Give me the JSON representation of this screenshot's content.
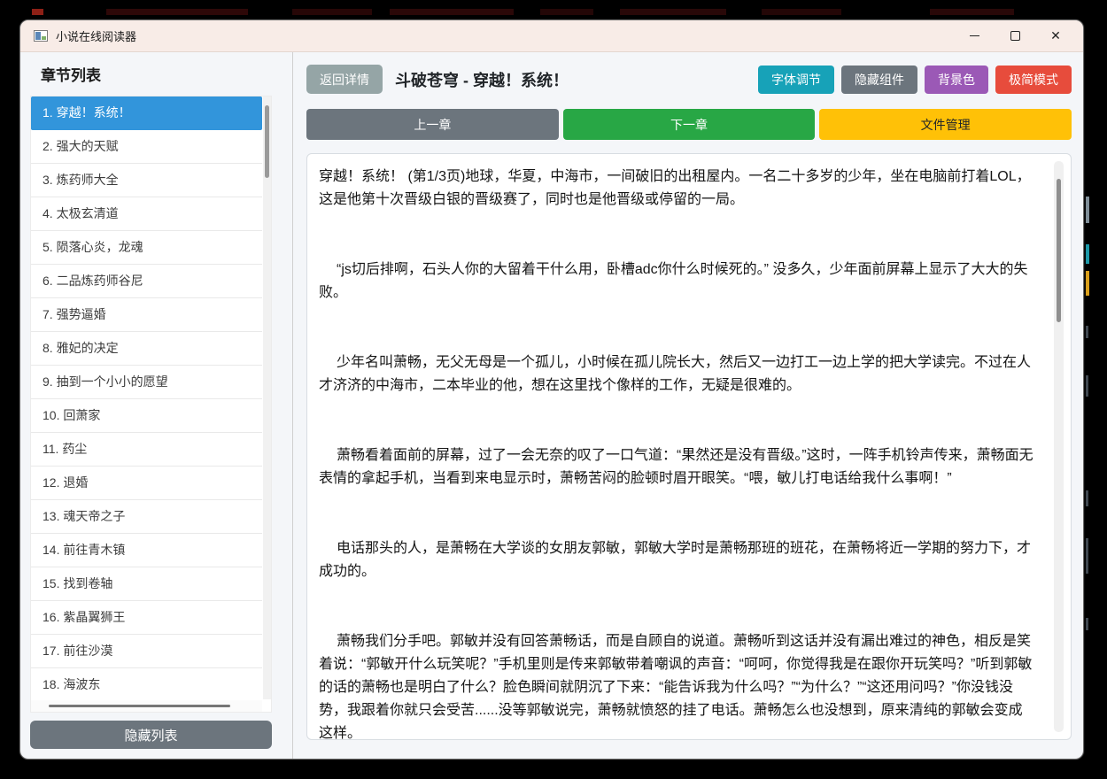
{
  "window": {
    "title": "小说在线阅读器"
  },
  "sidebar": {
    "title": "章节列表",
    "hide_button": "隐藏列表",
    "active_index": 0,
    "chapters": [
      "1. 穿越！系统！",
      "2. 强大的天赋",
      "3. 炼药师大全",
      "4. 太极玄清道",
      "5. 陨落心炎，龙魂",
      "6. 二品炼药师谷尼",
      "7. 强势逼婚",
      "8. 雅妃的决定",
      "9. 抽到一个小小的愿望",
      "10. 回萧家",
      "11. 药尘",
      "12. 退婚",
      "13. 魂天帝之子",
      "14. 前往青木镇",
      "15. 找到卷轴",
      "16. 紫晶翼狮王",
      "17. 前往沙漠",
      "18. 海波东"
    ]
  },
  "toolbar": {
    "back_button": "返回详情",
    "chapter_title": "斗破苍穹 - 穿越！系统！",
    "action_buttons": [
      {
        "id": "font-adjust",
        "label": "字体调节",
        "color": "#17a2b8"
      },
      {
        "id": "hide-widgets",
        "label": "隐藏组件",
        "color": "#6c757d"
      },
      {
        "id": "background-color",
        "label": "背景色",
        "color": "#9b59b6"
      },
      {
        "id": "minimal-mode",
        "label": "极简模式",
        "color": "#e74c3c"
      }
    ]
  },
  "nav": {
    "prev_button": {
      "label": "上一章",
      "color": "#6c757d"
    },
    "next_button": {
      "label": "下一章",
      "color": "#28a745"
    },
    "file_button": {
      "label": "文件管理",
      "color": "#ffc107"
    }
  },
  "reader": {
    "page_indicator": "第1/3页",
    "paragraphs": [
      "穿越！系统！ (第1/3页)地球，华夏，中海市，一间破旧的出租屋内。一名二十多岁的少年，坐在电脑前打着LOL，这是他第十次晋级白银的晋级赛了，同时也是他晋级或停留的一局。",
      "“js切后排啊，石头人你的大留着干什么用，卧槽adc你什么时候死的。” 没多久，少年面前屏幕上显示了大大的失败。",
      "少年名叫萧畅，无父无母是一个孤儿，小时候在孤儿院长大，然后又一边打工一边上学的把大学读完。不过在人才济济的中海市，二本毕业的他，想在这里找个像样的工作，无疑是很难的。",
      "萧畅看着面前的屏幕，过了一会无奈的叹了一口气道：“果然还是没有晋级。”这时，一阵手机铃声传来，萧畅面无表情的拿起手机，当看到来电显示时，萧畅苦闷的脸顿时眉开眼笑。“喂，敏儿打电话给我什么事啊！”",
      "电话那头的人，是萧畅在大学谈的女朋友郭敏，郭敏大学时是萧畅那班的班花，在萧畅将近一学期的努力下，才成功的。",
      "萧畅我们分手吧。郭敏并没有回答萧畅话，而是自顾自的说道。萧畅听到这话并没有漏出难过的神色，相反是笑着说：“郭敏开什么玩笑呢？”手机里则是传来郭敏带着嘲讽的声音：“呵呵，你觉得我是在跟你开玩笑吗？”听到郭敏的话的萧畅也是明白了什么？脸色瞬间就阴沉了下来：“能告诉我为什么吗？”“为什么？”“这还用问吗？”你没钱没势，我跟着你就只会受苦......没等郭敏说完，萧畅就愤怒的挂了电话。萧畅怎么也没想到，原来清纯的郭敏会变成这样。"
    ]
  },
  "colors": {
    "selected_chapter": "#3295db",
    "titlebar": "#f8ece7",
    "back_button": "#95a5a6",
    "hide_list_button": "#6c757d",
    "panel_background": "#ffffff"
  }
}
